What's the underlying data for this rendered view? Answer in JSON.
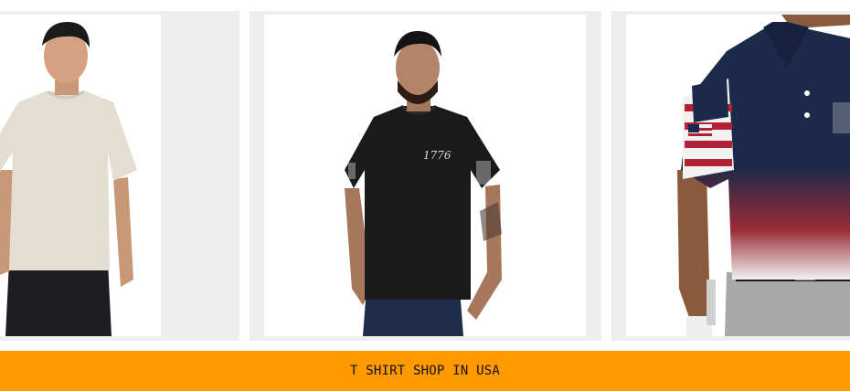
{
  "products": [
    {
      "name": "product-beige-tshirt",
      "alt": "beige t-shirt"
    },
    {
      "name": "product-black-1776-tshirt",
      "print_text": "1776",
      "alt": "black t-shirt"
    },
    {
      "name": "product-american-flag-polo",
      "alt": "flag polo shirt"
    }
  ],
  "banner": {
    "label": "T SHIRT SHOP IN USA"
  },
  "colors": {
    "banner_bg": "#ff9900",
    "card_bg": "#eeeeee",
    "navy": "#1c2a4a",
    "flag_red": "#b22234"
  }
}
